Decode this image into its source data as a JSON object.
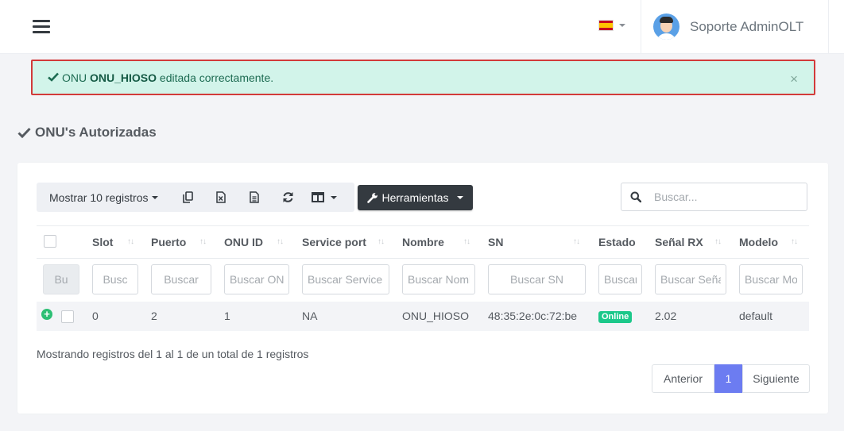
{
  "header": {
    "language": "es",
    "user_name": "Soporte AdminOLT"
  },
  "alert": {
    "prefix": "ONU",
    "onu_name": "ONU_HIOSO",
    "suffix": "editada correctamente.",
    "close": "×"
  },
  "page_title": "ONU's Autorizadas",
  "toolbar": {
    "length_label": "Mostrar 10 registros",
    "tools_label": "Herramientas",
    "search_placeholder": "Buscar..."
  },
  "table": {
    "columns": [
      "Slot",
      "Puerto",
      "ONU ID",
      "Service port",
      "Nombre",
      "SN",
      "Estado",
      "Señal RX",
      "Modelo"
    ],
    "filters": [
      "Bu",
      "Busc",
      "Buscar",
      "Buscar ONU ID",
      "Buscar Service port",
      "Buscar Nombre",
      "Buscar SN",
      "Buscar Estado",
      "Buscar Señal RX",
      "Buscar Modelo"
    ],
    "rows": [
      {
        "slot": "0",
        "puerto": "2",
        "onu_id": "1",
        "service_port": "NA",
        "nombre": "ONU_HIOSO",
        "sn": "48:35:2e:0c:72:be",
        "estado": "Online",
        "senal_rx": "2.02",
        "modelo": "default"
      }
    ]
  },
  "info": "Mostrando registros del 1 al 1 de un total de 1 registros",
  "pagination": {
    "prev": "Anterior",
    "current": "1",
    "next": "Siguiente"
  },
  "colors": {
    "accent": "#6c7cf1",
    "online": "#1cc88a",
    "alert_bg": "#d2f4ea",
    "dark": "#343a40"
  }
}
